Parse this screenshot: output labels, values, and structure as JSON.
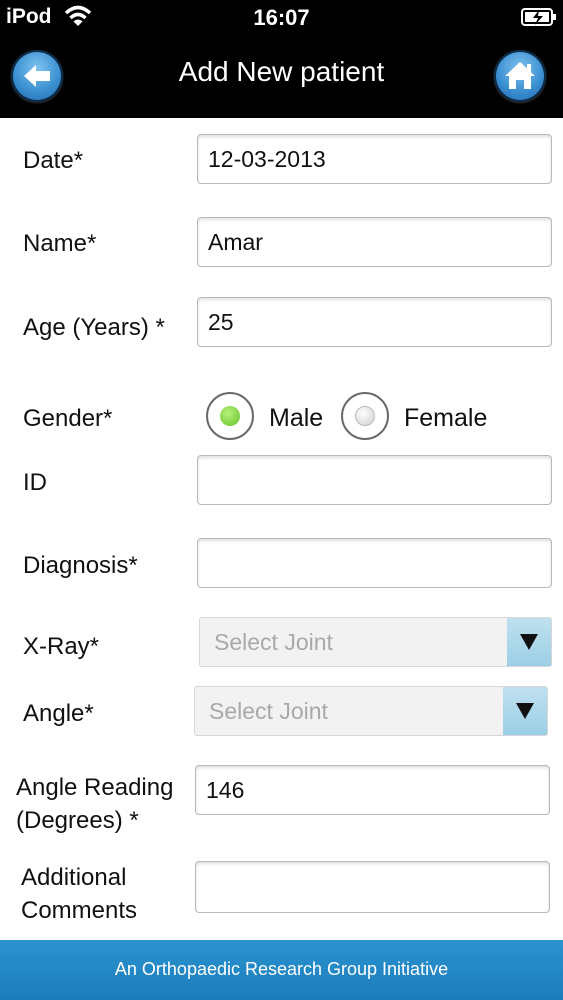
{
  "status_bar": {
    "carrier": "iPod",
    "time": "16:07"
  },
  "nav": {
    "title": "Add New patient",
    "back_icon": "back-arrow-icon",
    "home_icon": "home-icon"
  },
  "form": {
    "date": {
      "label": "Date*",
      "value": "12-03-2013"
    },
    "name": {
      "label": "Name*",
      "value": "Amar"
    },
    "age": {
      "label": "Age (Years) *",
      "value": "25"
    },
    "gender": {
      "label": "Gender*",
      "options": [
        "Male",
        "Female"
      ],
      "selected": "Male"
    },
    "id": {
      "label": "ID",
      "value": ""
    },
    "diagnosis": {
      "label": "Diagnosis*",
      "value": ""
    },
    "xray": {
      "label": "X-Ray*",
      "placeholder": "Select Joint"
    },
    "angle": {
      "label": "Angle*",
      "placeholder": "Select Joint"
    },
    "angle_reading": {
      "label_line1": "Angle Reading",
      "label_line2": "(Degrees) *",
      "value": "146"
    },
    "comments": {
      "label_line1": "Additional",
      "label_line2": "Comments",
      "value": ""
    }
  },
  "footer": {
    "text": "An Orthopaedic Research Group Initiative"
  },
  "colors": {
    "footer": "#1f84c2",
    "radio_selected": "#7bd13a",
    "nav_bg": "#000000"
  }
}
